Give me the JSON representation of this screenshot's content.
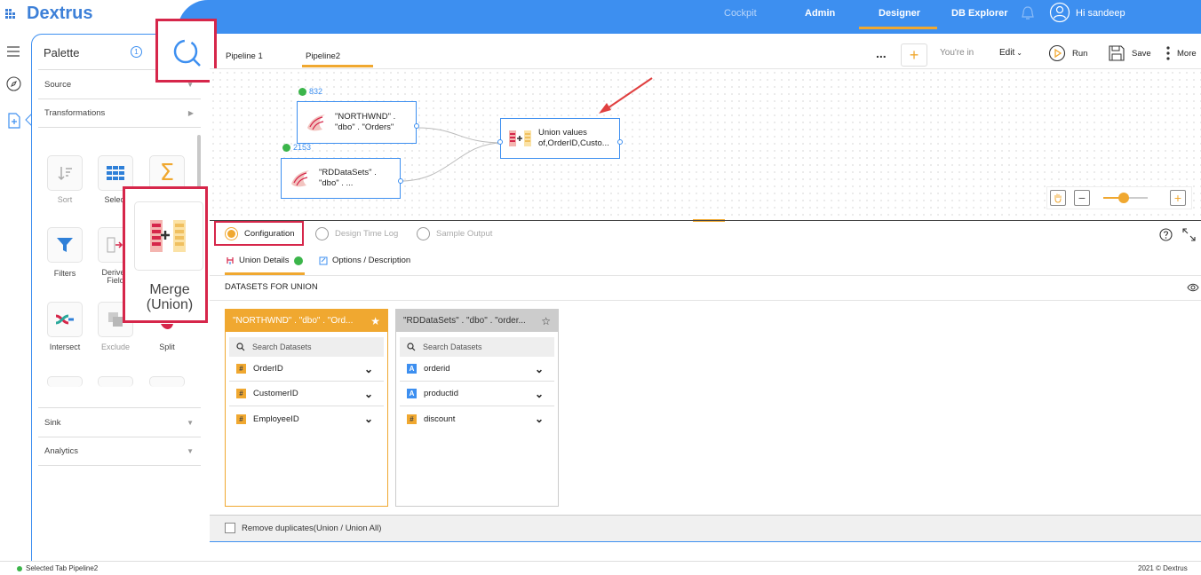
{
  "app": {
    "logo_text": "Dextrus"
  },
  "nav": {
    "cockpit": "Cockpit",
    "admin": "Admin",
    "designer": "Designer",
    "db_explorer": "DB Explorer",
    "user_greeting": "Hi sandeep"
  },
  "palette": {
    "title": "Palette",
    "info_num": "1",
    "sections": {
      "source": "Source",
      "transformations": "Transformations",
      "sink": "Sink",
      "analytics": "Analytics"
    },
    "tools": [
      {
        "label": "Sort",
        "icon": "sort-icon"
      },
      {
        "label": "Select",
        "icon": "select-icon"
      },
      {
        "label": "",
        "icon": "sigma-icon"
      },
      {
        "label": "Filters",
        "icon": "filter-icon"
      },
      {
        "label": "Derived Field",
        "icon": "derived-field-icon"
      },
      {
        "label": "Intersect",
        "icon": "intersect-icon"
      },
      {
        "label": "Exclude",
        "icon": "exclude-icon"
      },
      {
        "label": "Split",
        "icon": "split-icon"
      }
    ],
    "tooltip_label": "Merge (Union)"
  },
  "tabs": {
    "pipeline1": "Pipeline 1",
    "pipeline2": "Pipeline2"
  },
  "toolbar": {
    "dots": "...",
    "youre_in": "You're in",
    "edit": "Edit",
    "run": "Run",
    "save": "Save",
    "more": "More"
  },
  "nodes": {
    "n1": {
      "count": "832",
      "line1": "\"NORTHWND\" .",
      "line2": "\"dbo\" . \"Orders\""
    },
    "n2": {
      "count": "2153",
      "line1": "\"RDDataSets\" .",
      "line2": "\"dbo\" . ..."
    },
    "union": {
      "line1": "Union values",
      "line2": "of,OrderID,Custo..."
    }
  },
  "config": {
    "tabs": {
      "configuration": "Configuration",
      "design_time_log": "Design Time Log",
      "sample_output": "Sample Output"
    },
    "subtabs": {
      "union_details": "Union Details",
      "options": "Options / Description"
    },
    "datasets_header": "DATASETS FOR UNION",
    "search_placeholder": "Search Datasets",
    "dataset1": {
      "title": "\"NORTHWND\" . \"dbo\" . \"Ord...",
      "fields": [
        {
          "type": "#",
          "name": "OrderID"
        },
        {
          "type": "#",
          "name": "CustomerID"
        },
        {
          "type": "#",
          "name": "EmployeeID"
        }
      ]
    },
    "dataset2": {
      "title": "\"RDDataSets\" . \"dbo\" . \"order...",
      "fields": [
        {
          "type": "A",
          "name": "orderid"
        },
        {
          "type": "A",
          "name": "productid"
        },
        {
          "type": "#",
          "name": "discount"
        }
      ]
    },
    "remove_duplicates": "Remove duplicates(Union / Union All)"
  },
  "footer": {
    "status": "Selected Tab Pipeline2",
    "copyright": "2021 © Dextrus"
  },
  "colors": {
    "brand_blue": "#3d8ff0",
    "accent_orange": "#f0a830",
    "highlight_red": "#d6264a"
  }
}
